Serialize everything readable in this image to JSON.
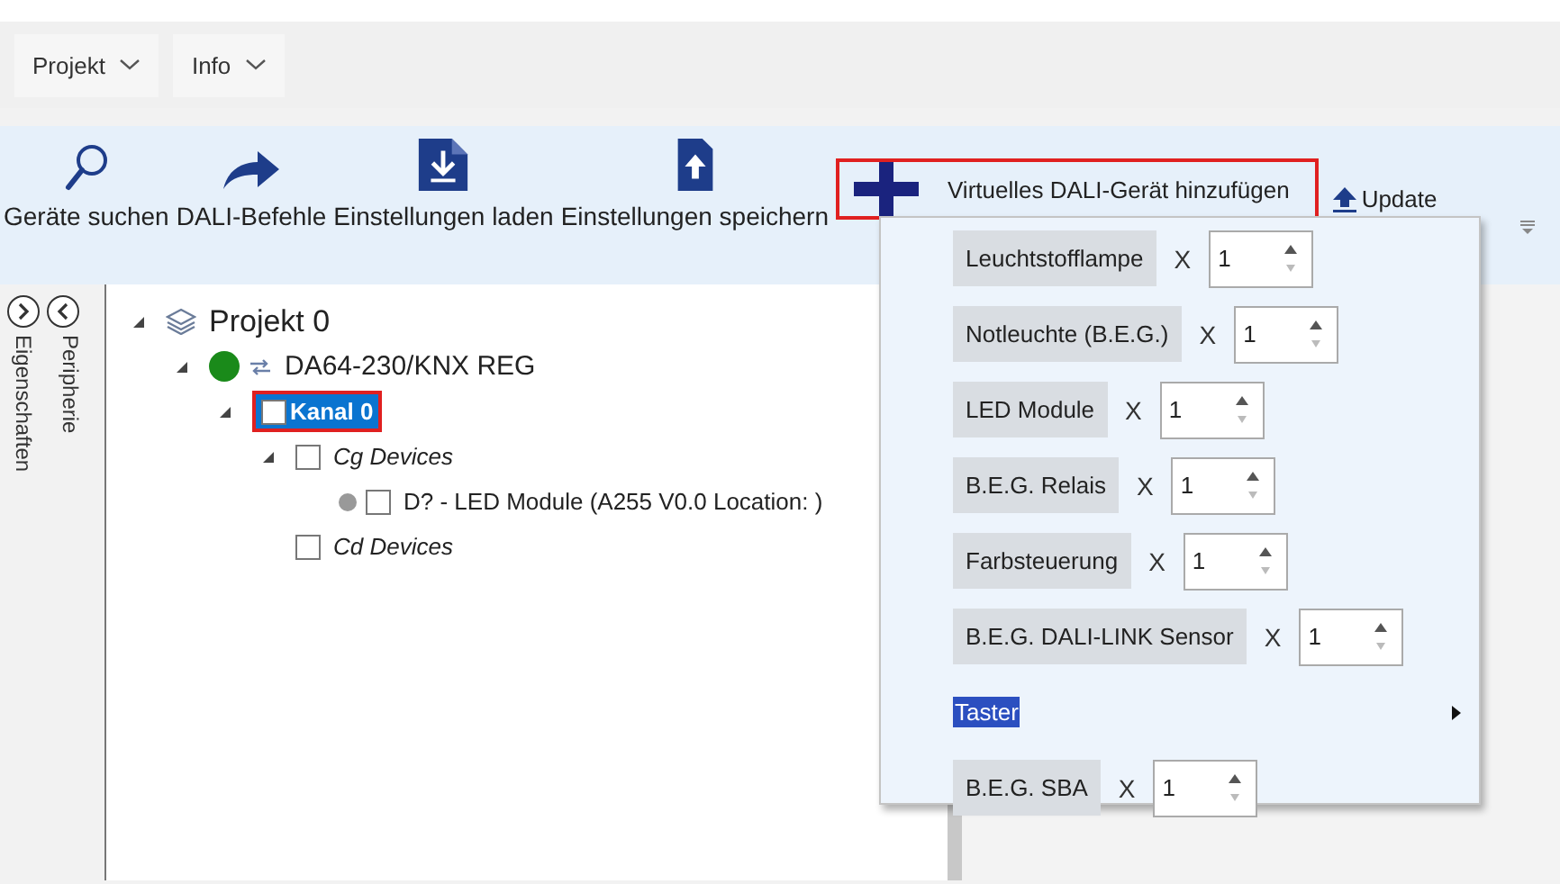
{
  "menu": [
    {
      "label": "Projekt"
    },
    {
      "label": "Info"
    }
  ],
  "toolbar": [
    {
      "kind": "search",
      "label": "Geräte suchen"
    },
    {
      "kind": "send",
      "label": "DALI-Befehle"
    },
    {
      "kind": "load",
      "label": "Einstellungen laden"
    },
    {
      "kind": "save",
      "label": "Einstellungen speichern"
    },
    {
      "kind": "add",
      "label": "Virtuelles DALI-Gerät hinzufügen",
      "highlighted": true
    },
    {
      "kind": "update",
      "label": "Update"
    }
  ],
  "side_tabs": [
    {
      "label": "Eigenschaften"
    },
    {
      "label": "Peripherie"
    }
  ],
  "tree": [
    {
      "kind": "project",
      "label": "Projekt 0",
      "expanded": true,
      "selected": false,
      "highlighted": false,
      "children": [
        {
          "kind": "device",
          "label": "DA64-230/KNX REG",
          "color": "#1a8a1a",
          "expanded": true,
          "selected": false,
          "highlighted": false,
          "children": [
            {
              "kind": "channel",
              "label": "Kanal 0",
              "checked": false,
              "expanded": true,
              "selected": true,
              "highlighted": true,
              "children": [
                {
                  "kind": "group",
                  "label": "Cg Devices",
                  "checked": false,
                  "expanded": true,
                  "selected": false,
                  "highlighted": false,
                  "children": [
                    {
                      "kind": "module",
                      "label": "D? - LED Module (A255 V0.0 Location: )",
                      "color": "#999999",
                      "checked": false,
                      "selected": false,
                      "highlighted": false
                    }
                  ]
                },
                {
                  "kind": "group",
                  "label": "Cd Devices",
                  "checked": false,
                  "selected": false,
                  "highlighted": false
                }
              ]
            }
          ]
        }
      ]
    }
  ],
  "add_menu": [
    {
      "kind": "counter",
      "label": "Leuchtstofflampe",
      "times": "X",
      "value": "1",
      "selected": false
    },
    {
      "kind": "counter",
      "label": "Notleuchte (B.E.G.)",
      "times": "X",
      "value": "1",
      "selected": false
    },
    {
      "kind": "counter",
      "label": "LED Module",
      "times": "X",
      "value": "1",
      "selected": false
    },
    {
      "kind": "counter",
      "label": "B.E.G. Relais",
      "times": "X",
      "value": "1",
      "selected": false
    },
    {
      "kind": "counter",
      "label": "Farbsteuerung",
      "times": "X",
      "value": "1",
      "selected": false
    },
    {
      "kind": "counter",
      "label": "B.E.G. DALI-LINK Sensor",
      "times": "X",
      "value": "1",
      "selected": false
    },
    {
      "kind": "submenu",
      "label": "Taster",
      "selected": true
    },
    {
      "kind": "counter",
      "label": "B.E.G. SBA",
      "times": "X",
      "value": "1",
      "selected": false
    }
  ]
}
